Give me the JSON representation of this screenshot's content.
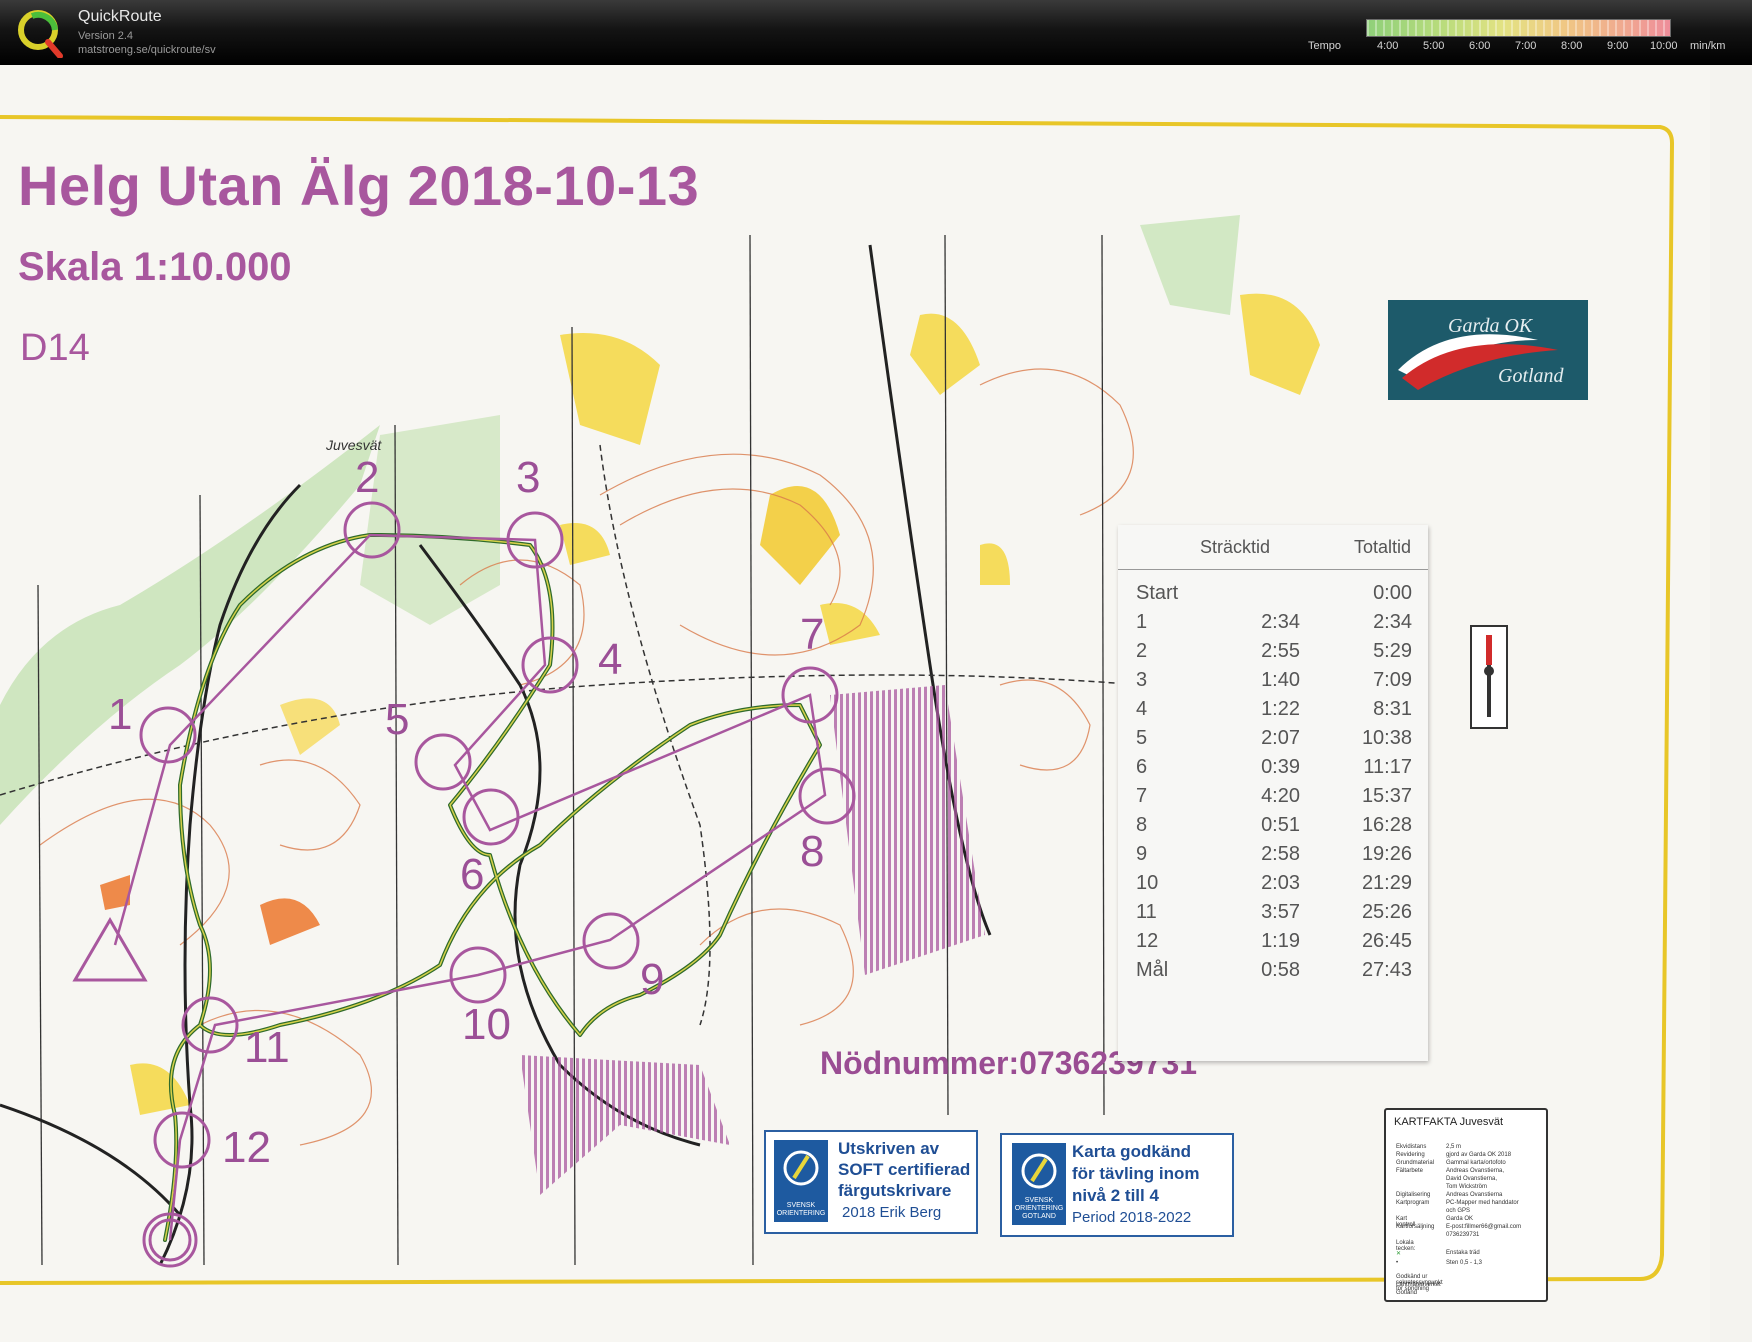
{
  "app": {
    "title": "QuickRoute",
    "version": "Version 2.4",
    "url": "matstroeng.se/quickroute/sv"
  },
  "tempo": {
    "label": "Tempo",
    "ticks": [
      "4:00",
      "5:00",
      "6:00",
      "7:00",
      "8:00",
      "9:00",
      "10:00"
    ],
    "unit": "min/km",
    "colors": [
      "#8fd07a",
      "#e3e283",
      "#f0c884",
      "#ee8d9a"
    ]
  },
  "map": {
    "title": "Helg Utan Älg 2018-10-13",
    "scale": "Skala 1:10.000",
    "class": "D14",
    "place": "Juvesvät",
    "emergency": "Nödnummer:0736239731",
    "controls": [
      "1",
      "2",
      "3",
      "4",
      "5",
      "6",
      "7",
      "8",
      "9",
      "10",
      "11",
      "12"
    ],
    "course_color": "#a8579e"
  },
  "splits": {
    "header_leg": "Sträcktid",
    "header_total": "Totaltid",
    "rows": [
      {
        "name": "Start",
        "leg": "",
        "total": "0:00"
      },
      {
        "name": "1",
        "leg": "2:34",
        "total": "2:34"
      },
      {
        "name": "2",
        "leg": "2:55",
        "total": "5:29"
      },
      {
        "name": "3",
        "leg": "1:40",
        "total": "7:09"
      },
      {
        "name": "4",
        "leg": "1:22",
        "total": "8:31"
      },
      {
        "name": "5",
        "leg": "2:07",
        "total": "10:38"
      },
      {
        "name": "6",
        "leg": "0:39",
        "total": "11:17"
      },
      {
        "name": "7",
        "leg": "4:20",
        "total": "15:37"
      },
      {
        "name": "8",
        "leg": "0:51",
        "total": "16:28"
      },
      {
        "name": "9",
        "leg": "2:58",
        "total": "19:26"
      },
      {
        "name": "10",
        "leg": "2:03",
        "total": "21:29"
      },
      {
        "name": "11",
        "leg": "3:57",
        "total": "25:26"
      },
      {
        "name": "12",
        "leg": "1:19",
        "total": "26:45"
      },
      {
        "name": "Mål",
        "leg": "0:58",
        "total": "27:43"
      }
    ]
  },
  "club": {
    "name": "Garda OK",
    "region": "Gotland"
  },
  "certs": [
    {
      "lines": [
        "Utskriven av",
        "SOFT certifierad",
        "färgutskrivare"
      ],
      "sub": "2018  Erik Berg",
      "icon_label": "SVENSK ORIENTERING"
    },
    {
      "lines": [
        "Karta godkänd",
        "för tävling inom",
        "nivå 2 till 4"
      ],
      "sub": "Period 2018-2022",
      "icon_label": "SVENSK ORIENTERING GOTLAND"
    }
  ],
  "facts": {
    "title": "KARTFAKTA Juvesvät",
    "rows": [
      {
        "k": "Ekvidistans",
        "v": "2,5 m"
      },
      {
        "k": "Revidering",
        "v": "gjord av Garda OK 2018"
      },
      {
        "k": "Grundmaterial",
        "v": "Gammal karta/ortofoto"
      },
      {
        "k": "Fältarbete",
        "v": "Andreas Ovanstierna,"
      },
      {
        "k": "",
        "v": "David Ovanstierna,"
      },
      {
        "k": "",
        "v": "Tom Wickström"
      },
      {
        "k": "Digitalisering",
        "v": "Andreas Ovanstierna"
      },
      {
        "k": "Kartprogram",
        "v": "PC-Mapper med handdator"
      },
      {
        "k": "",
        "v": "och GPS"
      },
      {
        "k": "Kart kontroll",
        "v": "Garda OK"
      },
      {
        "k": "Kartförsäljning",
        "v": "E-post:fillmer66@gmail.com"
      },
      {
        "k": "",
        "v": "0736239731"
      },
      {
        "k": "Lokala tecken:",
        "v": ""
      },
      {
        "k": "",
        "v": "Enstaka träd"
      },
      {
        "k": "",
        "v": "Sten 0,5 - 1,3"
      },
      {
        "k": "Godkänd ur sekretessynpunkt för spridning",
        "v": ""
      },
      {
        "k": "Lantmäteriverket",
        "v": ""
      },
      {
        "k": "Gotland",
        "v": ""
      }
    ]
  }
}
